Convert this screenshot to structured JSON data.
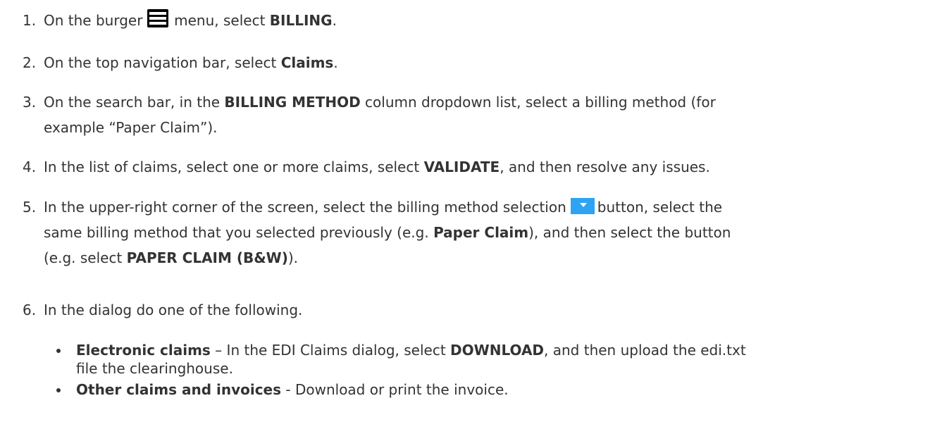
{
  "steps": [
    {
      "num": "1.",
      "t1": "On the burger ",
      "t2": " menu, select ",
      "b1": "BILLING",
      "t3": "."
    },
    {
      "num": "2.",
      "t1": "On the top navigation bar, select ",
      "b1": "Claims",
      "t2": "."
    },
    {
      "num": "3.",
      "t1": "On the search bar, in the ",
      "b1": "BILLING METHOD",
      "t2": " column dropdown list, select a billing method (for",
      "t3": "example “Paper Claim”)."
    },
    {
      "num": "4.",
      "t1": "In the list of claims, select one or more claims, select ",
      "b1": "VALIDATE",
      "t2": ", and then resolve any issues."
    },
    {
      "num": "5.",
      "t1": "In the upper-right corner of the screen, select the billing method selection",
      "t2": "button, select the",
      "t3": "same billing method that you selected previously (e.g. ",
      "b1": "Paper Claim",
      "t4": "), and then select the button",
      "t5": "(e.g. select ",
      "b2": "PAPER CLAIM (B&W)",
      "t6": ")."
    },
    {
      "num": "6.",
      "t1": "In the dialog do one of the following."
    }
  ],
  "bullets": [
    {
      "b": "Electronic claims",
      "t1": " – In the EDI Claims dialog, select ",
      "b2": "DOWNLOAD",
      "t2": ", and then upload the edi.txt",
      "t3": "file the clearinghouse."
    },
    {
      "b": "Other claims and invoices",
      "t1": " - Download or print the invoice."
    }
  ],
  "icons": {
    "burger": "burger-menu-icon",
    "dropdown": "dropdown-button-icon",
    "dropdown_color": "#2ea3f2"
  }
}
